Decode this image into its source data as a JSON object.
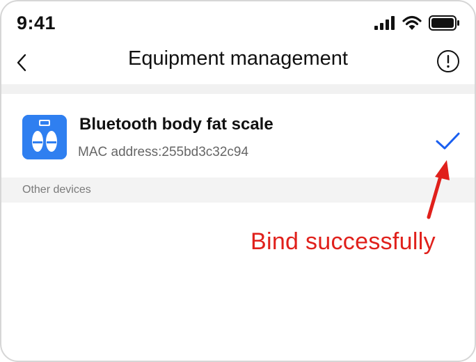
{
  "status_bar": {
    "time": "9:41",
    "icons": [
      "cellular-signal-icon",
      "wifi-icon",
      "battery-icon"
    ]
  },
  "nav": {
    "title": "Equipment management",
    "back_icon": "chevron-left-icon",
    "info_icon": "info-circle-icon"
  },
  "device": {
    "name": "Bluetooth body fat scale",
    "mac": "MAC address:255bd3c32c94",
    "icon": "body-scale-icon",
    "status_icon": "checkmark-icon"
  },
  "sections": {
    "other_devices": "Other devices"
  },
  "annotation": {
    "text": "Bind successfully",
    "color": "#e0201b"
  },
  "colors": {
    "accent": "#2f7ff0",
    "check": "#1a5ff0",
    "annotation": "#e0201b"
  }
}
